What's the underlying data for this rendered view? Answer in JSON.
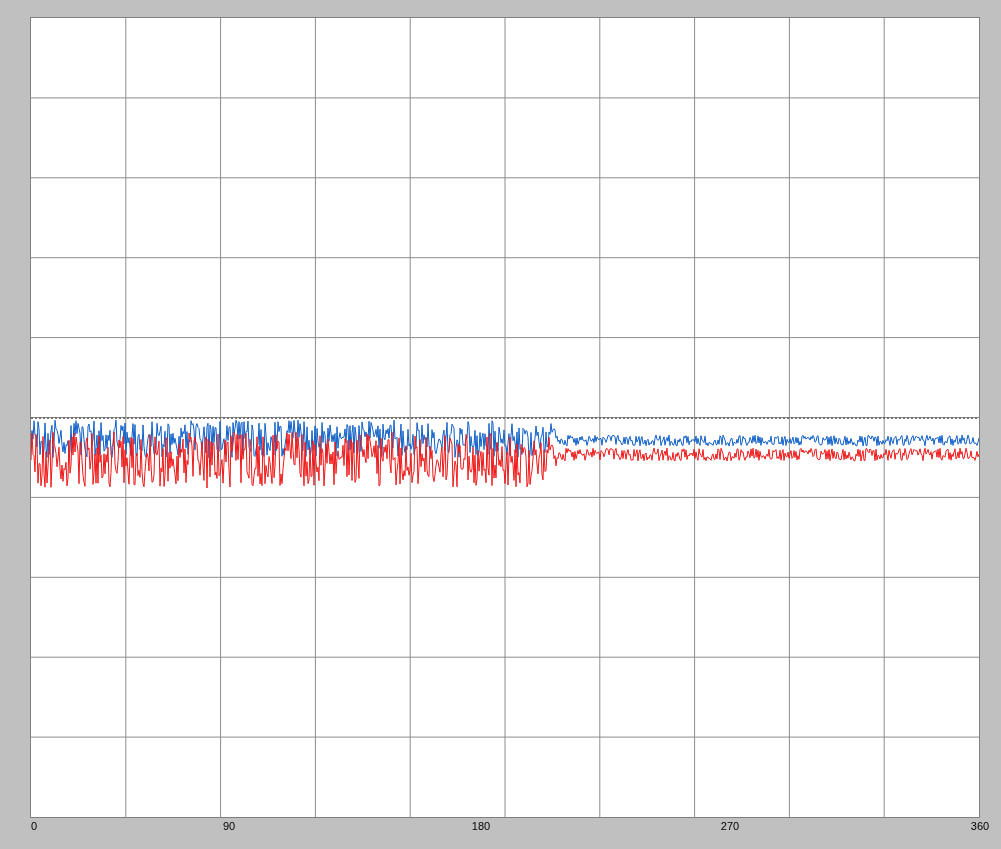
{
  "plot": {
    "x_axis_labels": [
      "0",
      "90",
      "180",
      "270",
      "360"
    ]
  }
}
